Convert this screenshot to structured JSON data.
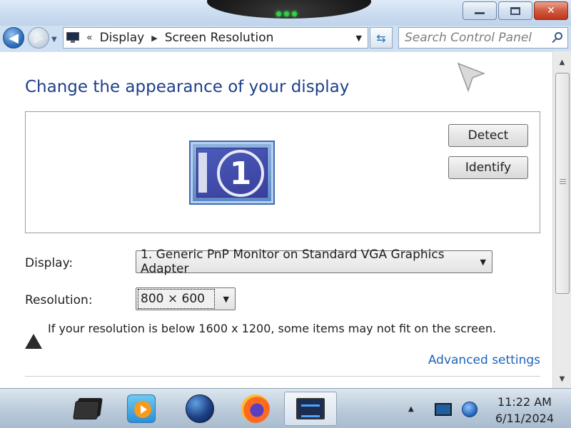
{
  "window": {
    "minimize_label": "",
    "maximize_label": "",
    "close_label": "✕"
  },
  "navigation": {
    "breadcrumb": [
      "Display",
      "Screen Resolution"
    ],
    "breadcrumb_overflow": "«",
    "search_placeholder": "Search Control Panel"
  },
  "main": {
    "title": "Change the appearance of your display",
    "monitor_number": "1",
    "detect_label": "Detect",
    "identify_label": "Identify",
    "display_label": "Display:",
    "display_value": "1. Generic PnP Monitor on Standard VGA Graphics Adapter",
    "resolution_label": "Resolution:",
    "resolution_value": "800 × 600",
    "warning_text": "If your resolution is below 1600 x 1200, some items may not fit on the screen.",
    "advanced_link": "Advanced settings"
  },
  "taskbar": {
    "items": [
      {
        "name": "tablet-icon"
      },
      {
        "name": "media-player-icon"
      },
      {
        "name": "globe-icon"
      },
      {
        "name": "firefox-icon"
      },
      {
        "name": "display-settings-icon",
        "active": true
      }
    ],
    "tray_icons": [
      "show-hidden-icons-icon",
      "action-center-monitor-icon",
      "network-icon"
    ],
    "time": "11:22 AM",
    "date": "6/11/2024"
  },
  "colors": {
    "title_blue": "#1e3f8a",
    "link_blue": "#1c63b7",
    "close_red": "#c1341a"
  }
}
